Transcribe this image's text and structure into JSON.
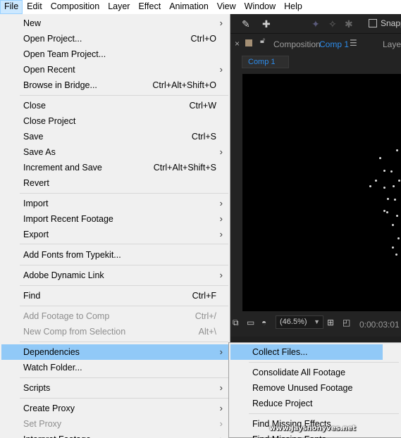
{
  "menubar": {
    "items": [
      "File",
      "Edit",
      "Composition",
      "Layer",
      "Effect",
      "Animation",
      "View",
      "Window",
      "Help"
    ],
    "active": "File"
  },
  "toolbar": {
    "snap_label": "Snapp"
  },
  "composition_panel": {
    "title_label": "Composition",
    "title_name": "Comp 1",
    "sub_tab": "Comp 1",
    "layer_tab": "Laye",
    "zoom": "(46.5%)",
    "timecode": "0:00:03:01"
  },
  "file_menu": [
    {
      "label": "New",
      "shortcut": "",
      "submenu": true,
      "disabled": false
    },
    {
      "label": "Open Project...",
      "shortcut": "Ctrl+O",
      "submenu": false,
      "disabled": false
    },
    {
      "label": "Open Team Project...",
      "shortcut": "",
      "submenu": false,
      "disabled": false
    },
    {
      "label": "Open Recent",
      "shortcut": "",
      "submenu": true,
      "disabled": false
    },
    {
      "label": "Browse in Bridge...",
      "shortcut": "Ctrl+Alt+Shift+O",
      "submenu": false,
      "disabled": false
    },
    {
      "label": "Close",
      "shortcut": "Ctrl+W",
      "submenu": false,
      "disabled": false
    },
    {
      "label": "Close Project",
      "shortcut": "",
      "submenu": false,
      "disabled": false
    },
    {
      "label": "Save",
      "shortcut": "Ctrl+S",
      "submenu": false,
      "disabled": false
    },
    {
      "label": "Save As",
      "shortcut": "",
      "submenu": true,
      "disabled": false
    },
    {
      "label": "Increment and Save",
      "shortcut": "Ctrl+Alt+Shift+S",
      "submenu": false,
      "disabled": false
    },
    {
      "label": "Revert",
      "shortcut": "",
      "submenu": false,
      "disabled": false
    },
    {
      "label": "Import",
      "shortcut": "",
      "submenu": true,
      "disabled": false
    },
    {
      "label": "Import Recent Footage",
      "shortcut": "",
      "submenu": true,
      "disabled": false
    },
    {
      "label": "Export",
      "shortcut": "",
      "submenu": true,
      "disabled": false
    },
    {
      "label": "Add Fonts from Typekit...",
      "shortcut": "",
      "submenu": false,
      "disabled": false
    },
    {
      "label": "Adobe Dynamic Link",
      "shortcut": "",
      "submenu": true,
      "disabled": false
    },
    {
      "label": "Find",
      "shortcut": "Ctrl+F",
      "submenu": false,
      "disabled": false
    },
    {
      "label": "Add Footage to Comp",
      "shortcut": "Ctrl+/",
      "submenu": false,
      "disabled": true
    },
    {
      "label": "New Comp from Selection",
      "shortcut": "Alt+\\",
      "submenu": false,
      "disabled": true
    },
    {
      "label": "Dependencies",
      "shortcut": "",
      "submenu": true,
      "disabled": false,
      "highlighted": true
    },
    {
      "label": "Watch Folder...",
      "shortcut": "",
      "submenu": false,
      "disabled": false
    },
    {
      "label": "Scripts",
      "shortcut": "",
      "submenu": true,
      "disabled": false
    },
    {
      "label": "Create Proxy",
      "shortcut": "",
      "submenu": true,
      "disabled": false
    },
    {
      "label": "Set Proxy",
      "shortcut": "",
      "submenu": true,
      "disabled": true
    },
    {
      "label": "Interpret Footage",
      "shortcut": "",
      "submenu": true,
      "disabled": false
    }
  ],
  "dependencies_submenu": [
    {
      "label": "Collect Files...",
      "highlighted": true
    },
    {
      "label": "Consolidate All Footage"
    },
    {
      "label": "Remove Unused Footage"
    },
    {
      "label": "Reduce Project"
    },
    {
      "label": "Find Missing Effects"
    },
    {
      "label": "Find Missing Fonts"
    }
  ],
  "watermark": "www.Jayshonyves.net"
}
